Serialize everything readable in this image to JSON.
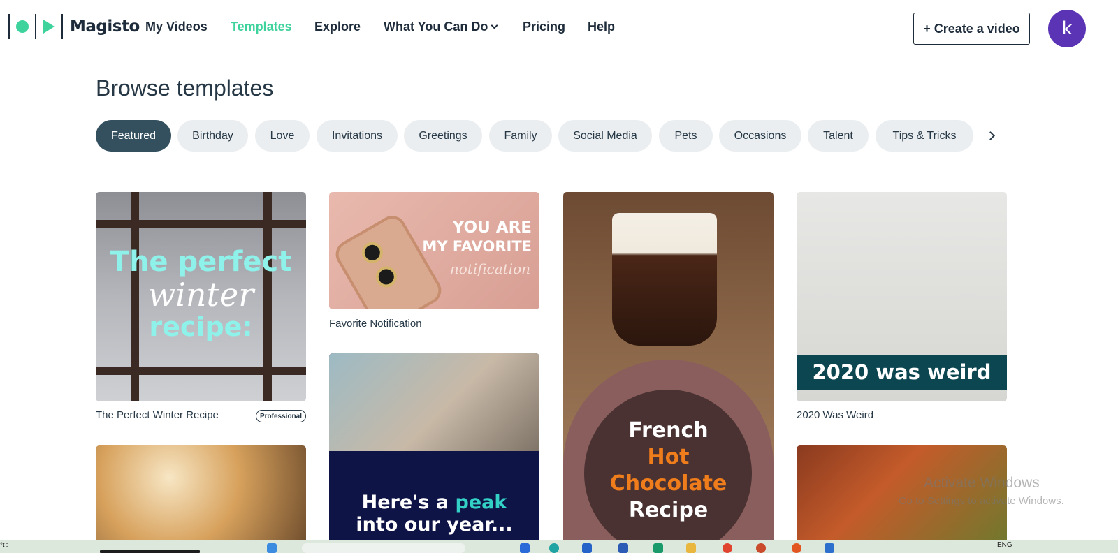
{
  "header": {
    "brand": "Magisto",
    "nav": [
      {
        "label": "My Videos",
        "active": false
      },
      {
        "label": "Templates",
        "active": true
      },
      {
        "label": "Explore",
        "active": false
      },
      {
        "label": "What You Can Do",
        "active": false,
        "dropdown": true
      },
      {
        "label": "Pricing",
        "active": false
      },
      {
        "label": "Help",
        "active": false
      }
    ],
    "create_button": "+ Create a video",
    "avatar_initial": "k"
  },
  "page": {
    "title": "Browse templates"
  },
  "categories": [
    {
      "label": "Featured",
      "active": true
    },
    {
      "label": "Birthday",
      "active": false
    },
    {
      "label": "Love",
      "active": false
    },
    {
      "label": "Invitations",
      "active": false
    },
    {
      "label": "Greetings",
      "active": false
    },
    {
      "label": "Family",
      "active": false
    },
    {
      "label": "Social Media",
      "active": false
    },
    {
      "label": "Pets",
      "active": false
    },
    {
      "label": "Occasions",
      "active": false
    },
    {
      "label": "Talent",
      "active": false
    },
    {
      "label": "Tips & Tricks",
      "active": false
    }
  ],
  "templates": [
    {
      "name": "The Perfect Winter Recipe",
      "badge": "Professional",
      "thumb_lines": [
        "The perfect",
        "winter",
        "recipe:"
      ]
    },
    {
      "name": "Favorite Notification",
      "thumb_lines": [
        "YOU ARE",
        "MY FAVORITE",
        "notification"
      ]
    },
    {
      "thumb_lines": [
        "Here's a ",
        "peak",
        "into our year..."
      ]
    },
    {
      "thumb_lines": [
        "French",
        "Hot",
        "Chocolate",
        "Recipe"
      ]
    },
    {
      "name": "2020 Was Weird",
      "thumb_lines": [
        "2020 was weird"
      ]
    }
  ],
  "watermark": {
    "line1": "Activate Windows",
    "line2": "Go to Settings to activate Windows."
  },
  "taskbar": {
    "temp": "°C",
    "lang": "ENG"
  },
  "colors": {
    "brand_green": "#3ed39c",
    "navy": "#1d2b3a",
    "chip_active": "#34505f",
    "chip_bg": "#ebeef0",
    "avatar": "#5b33b5"
  }
}
